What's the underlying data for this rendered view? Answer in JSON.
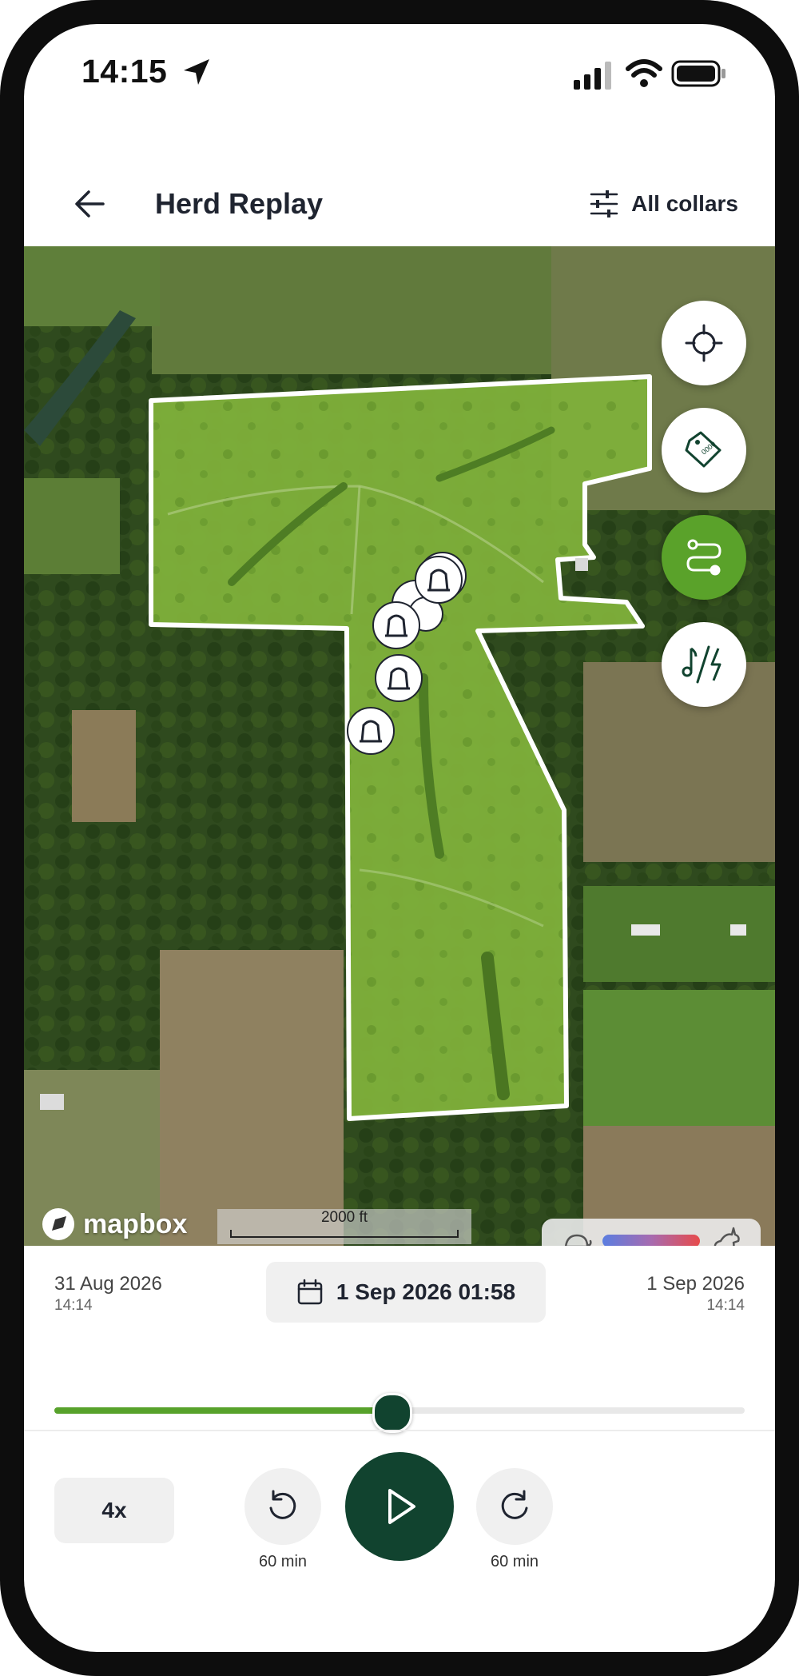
{
  "status_bar": {
    "time": "14:15"
  },
  "header": {
    "title": "Herd Replay",
    "filter_label": "All collars"
  },
  "map": {
    "attribution": "mapbox",
    "scale_label": "2000 ft",
    "legend": {
      "slow_icon": "turtle-icon",
      "fast_icon": "rabbit-icon",
      "gradient": [
        "#5b7ee0",
        "#e74b4b"
      ]
    },
    "buttons": [
      "crosshair-icon",
      "collar-tag-icon",
      "route-icon",
      "sound-shock-icon"
    ],
    "collar_markers": 6
  },
  "timeline": {
    "start_date": "31 Aug 2026",
    "start_time": "14:14",
    "current": "1 Sep 2026 01:58",
    "end_date": "1 Sep 2026",
    "end_time": "14:14",
    "progress": 0.49
  },
  "controls": {
    "speed": "4x",
    "rewind_label": "60 min",
    "forward_label": "60 min"
  },
  "colors": {
    "accent": "#57a22b",
    "primary_dark": "#11432f"
  }
}
